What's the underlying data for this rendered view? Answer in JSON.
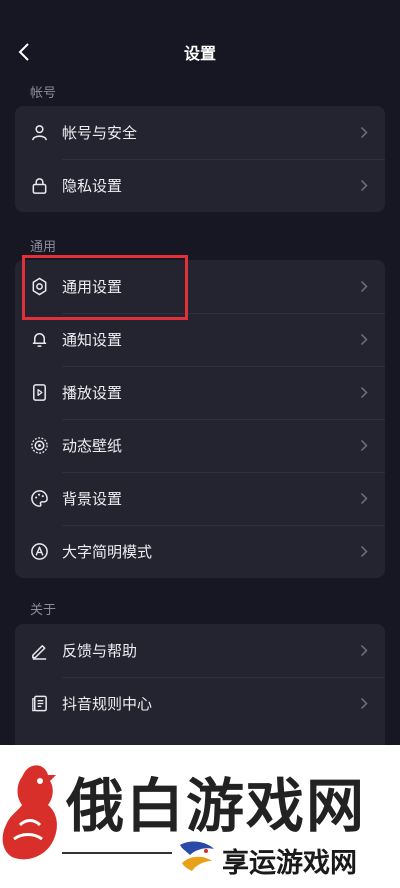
{
  "header": {
    "title": "设置"
  },
  "sections": [
    {
      "label": "帐号",
      "items": [
        {
          "label": "帐号与安全",
          "icon": "person-icon"
        },
        {
          "label": "隐私设置",
          "icon": "lock-icon"
        }
      ]
    },
    {
      "label": "通用",
      "items": [
        {
          "label": "通用设置",
          "icon": "gear-icon"
        },
        {
          "label": "通知设置",
          "icon": "bell-icon"
        },
        {
          "label": "播放设置",
          "icon": "play-settings-icon"
        },
        {
          "label": "动态壁纸",
          "icon": "dynamic-wallpaper-icon"
        },
        {
          "label": "背景设置",
          "icon": "palette-icon"
        },
        {
          "label": "大字简明模式",
          "icon": "large-font-icon"
        }
      ]
    },
    {
      "label": "关于",
      "items": [
        {
          "label": "反馈与帮助",
          "icon": "pencil-icon"
        },
        {
          "label": "抖音规则中心",
          "icon": "rules-doc-icon"
        }
      ]
    }
  ],
  "watermark": {
    "main": "俄白游戏网",
    "sub": "享运游戏网"
  },
  "colors": {
    "background": "#161722",
    "card": "#232430",
    "highlight": "#e0313a"
  }
}
